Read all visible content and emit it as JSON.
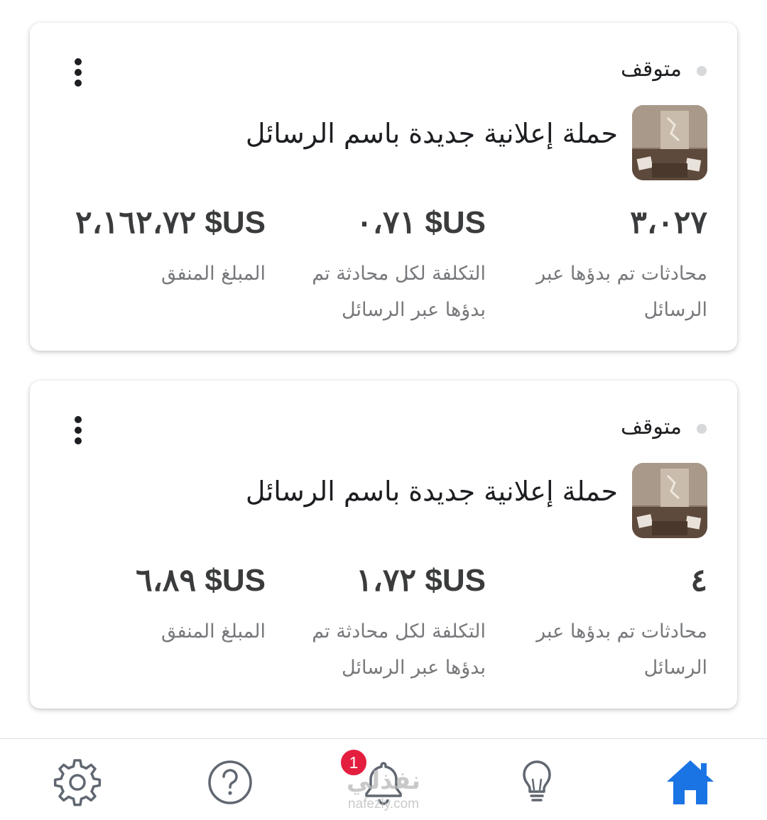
{
  "campaigns": [
    {
      "status": "متوقف",
      "name": "حملة إعلانية جديدة باسم الرسائل",
      "metrics": [
        {
          "value": "٣،٠٢٧",
          "label": "محادثات تم بدؤها عبر الرسائل"
        },
        {
          "value": "US$ ٠،٧١",
          "label": "التكلفة لكل محادثة تم بدؤها عبر الرسائل"
        },
        {
          "value": "US$ ٢،١٦٢،٧٢",
          "label": "المبلغ المنفق"
        }
      ]
    },
    {
      "status": "متوقف",
      "name": "حملة إعلانية جديدة باسم الرسائل",
      "metrics": [
        {
          "value": "٤",
          "label": "محادثات تم بدؤها عبر الرسائل"
        },
        {
          "value": "US$ ١،٧٢",
          "label": "التكلفة لكل محادثة تم بدؤها عبر الرسائل"
        },
        {
          "value": "US$ ٦،٨٩",
          "label": "المبلغ المنفق"
        }
      ]
    }
  ],
  "nav": {
    "items": [
      "settings-icon",
      "help-icon",
      "notifications-icon",
      "lightbulb-icon",
      "home-icon"
    ],
    "active": "home-icon",
    "notification_count": "1"
  },
  "watermark": {
    "logo": "نفذلي",
    "url": "nafezly.com"
  },
  "colors": {
    "accent": "#1b74e4",
    "badge": "#e41e3f",
    "status_dot": "#d7d8da",
    "label_gray": "#76787b"
  }
}
